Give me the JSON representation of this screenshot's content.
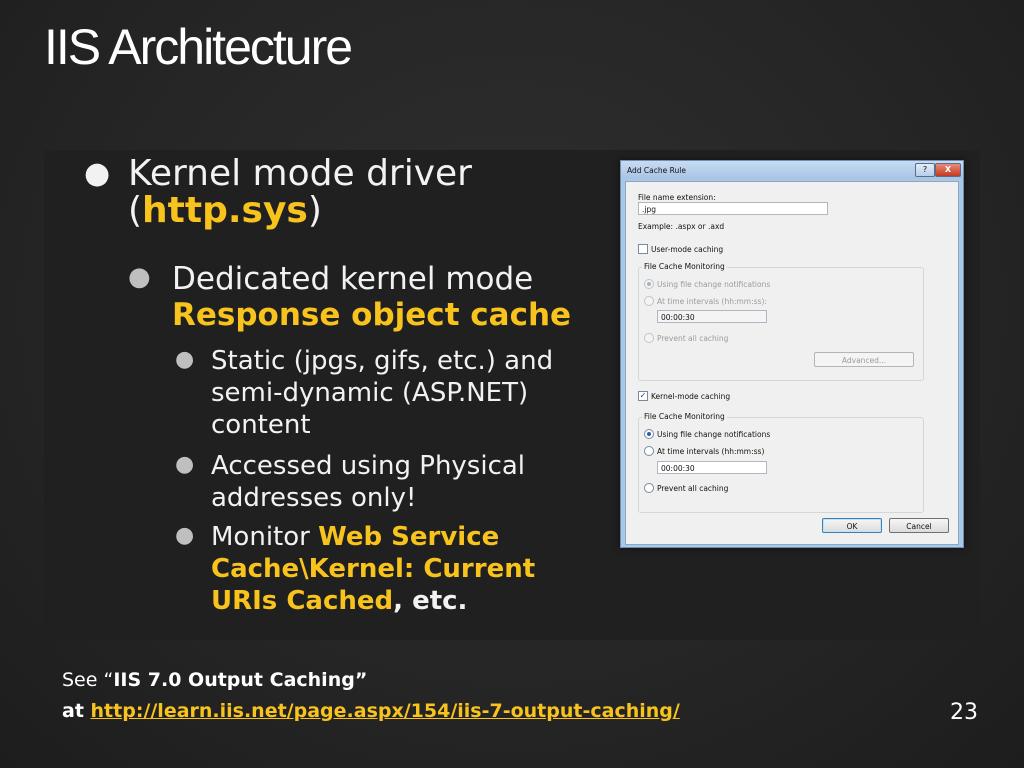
{
  "slide": {
    "title": "IIS Architecture",
    "page_number": "23"
  },
  "bullets": {
    "l1": {
      "text_pre": "Kernel mode driver (",
      "highlight": "http.sys",
      "text_post": ")"
    },
    "l2": {
      "text": "Dedicated kernel mode",
      "highlight": "Response object cache"
    },
    "l3": [
      {
        "text": "Static (jpgs, gifs, etc.) and semi-dynamic (ASP.NET) content"
      },
      {
        "text": "Accessed using Physical addresses only!"
      },
      {
        "text_pre": "Monitor ",
        "highlight": "Web Service Cache\\Kernel: Current URIs Cached",
        "text_post": ", etc."
      }
    ]
  },
  "footer": {
    "see": "See “",
    "ref_title": "IIS 7.0 Output Caching”",
    "at": "at ",
    "link": "http://learn.iis.net/page.aspx/154/iis-7-output-caching/"
  },
  "dialog": {
    "title": "Add Cache Rule",
    "help_glyph": "?",
    "close_glyph": "X",
    "file_ext_label": "File name extension:",
    "file_ext_value": ".jpg",
    "example": "Example: .aspx or .axd",
    "user_mode": {
      "checkbox_label": "User-mode caching",
      "checked": false,
      "group_label": "File Cache Monitoring",
      "opt_change": "Using file change notifications",
      "opt_interval": "At time intervals (hh:mm:ss):",
      "interval_value": "00:00:30",
      "opt_prevent": "Prevent all caching",
      "advanced_button": "Advanced..."
    },
    "kernel_mode": {
      "checkbox_label": "Kernel-mode caching",
      "checked": true,
      "group_label": "File Cache Monitoring",
      "opt_change": "Using file change notifications",
      "opt_interval": "At time intervals (hh:mm:ss)",
      "interval_value": "00:00:30",
      "opt_prevent": "Prevent all caching"
    },
    "ok_button": "OK",
    "cancel_button": "Cancel"
  },
  "colors": {
    "highlight": "#f8c31c",
    "background": "#262626"
  }
}
